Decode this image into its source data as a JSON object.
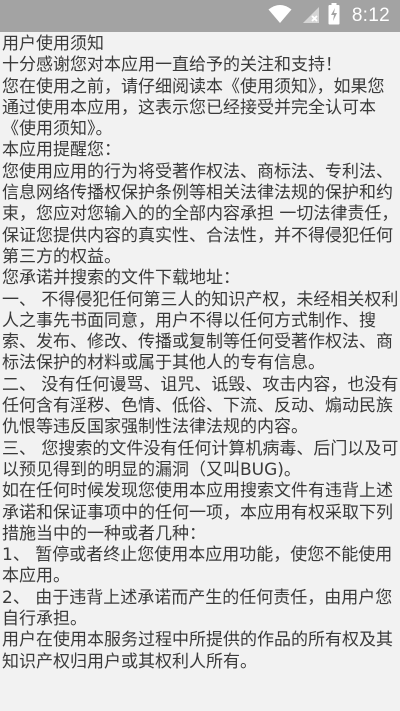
{
  "status_bar": {
    "time": "8:12",
    "icons": [
      "wifi-icon",
      "no-sim-icon",
      "battery-charging-icon"
    ]
  },
  "notice": {
    "paragraphs": [
      "用户使用须知",
      "十分感谢您对本应用一直给予的关注和支持！",
      "您在使用之前，请仔细阅读本《使用须知》，如果您通过使用本应用，这表示您已经接受并完全认可本《使用须知》。",
      "本应用提醒您：",
      "您使用应用的行为将受著作权法、商标法、专利法、信息网络传播权保护条例等相关法律法规的保护和约束，您应对您输入的的全部内容承担 一切法律责任，保证您提供内容的真实性、合法性，并不得侵犯任何第三方的权益。",
      "您承诺并搜索的文件下载地址：",
      "一、 不得侵犯任何第三人的知识产权，未经相关权利人之事先书面同意，用户不得以任何方式制作、搜索、发布、修改、传播或复制等任何受著作权法、商标法保护的材料或属于其他人的专有信息。",
      "二、 没有任何谩骂、诅咒、诋毁、攻击内容，也没有任何含有淫秽、色情、低俗、下流、反动、煽动民族仇恨等违反国家强制性法律法规的内容。",
      "三、 您搜索的文件没有任何计算机病毒、后门以及可以预见得到的明显的漏洞（又叫BUG)。",
      "如在任何时候发现您使用本应用搜索文件有违背上述承诺和保证事项中的任何一项，本应用有权采取下列措施当中的一种或者几种：",
      "1、 暂停或者终止您使用本应用功能，使您不能使用本应用。",
      "2、 由于违背上述承诺而产生的任何责任，由用户您自行承担。",
      "用户在使用本服务过程中所提供的作品的所有权及其知识产权归用户或其权利人所有。"
    ]
  }
}
